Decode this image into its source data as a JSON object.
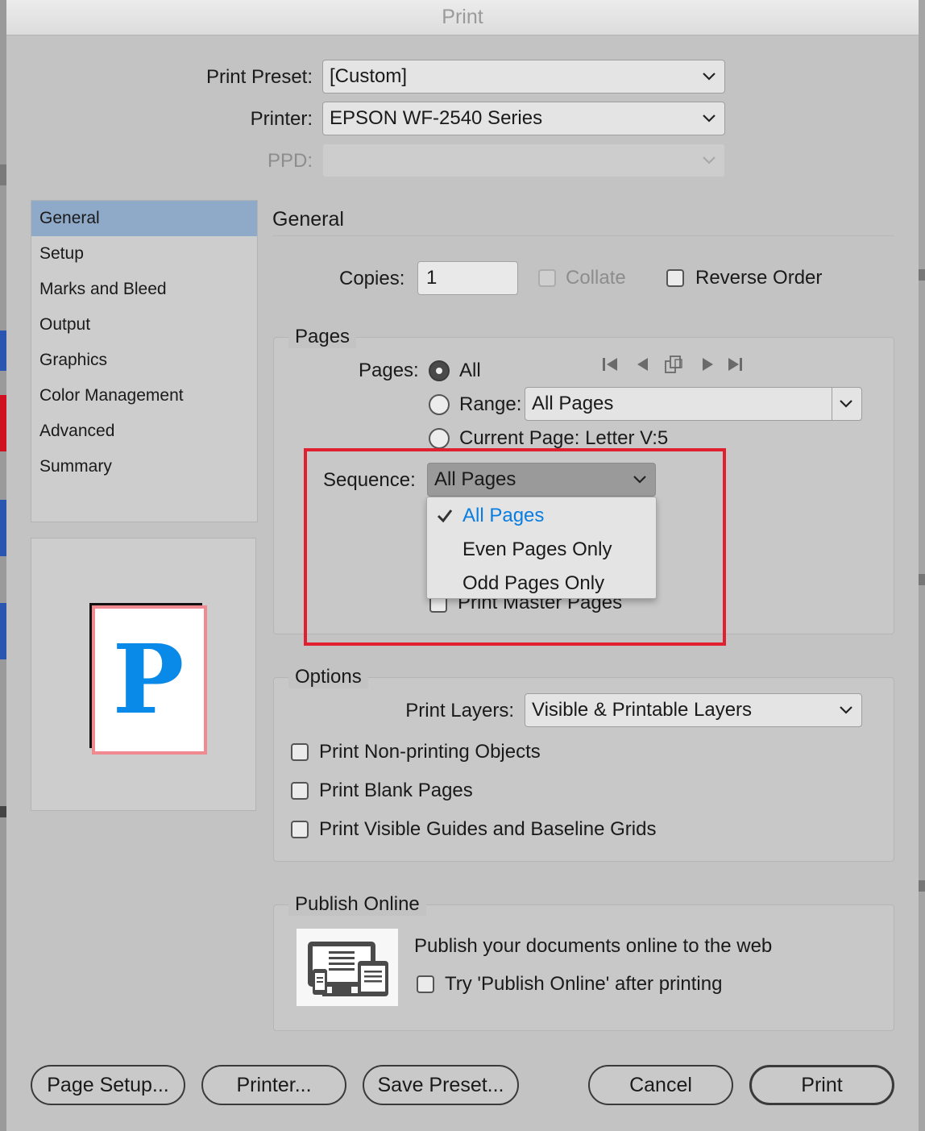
{
  "window": {
    "title": "Print"
  },
  "header": {
    "print_preset_label": "Print Preset:",
    "print_preset_value": "[Custom]",
    "printer_label": "Printer:",
    "printer_value": "EPSON WF-2540 Series",
    "ppd_label": "PPD:",
    "ppd_value": ""
  },
  "sidebar": {
    "selected": "General",
    "items": [
      {
        "label": "General"
      },
      {
        "label": "Setup"
      },
      {
        "label": "Marks and Bleed"
      },
      {
        "label": "Output"
      },
      {
        "label": "Graphics"
      },
      {
        "label": "Color Management"
      },
      {
        "label": "Advanced"
      },
      {
        "label": "Summary"
      }
    ]
  },
  "preview": {
    "glyph": "P",
    "glyph_color": "#0a8ae8",
    "border_color": "#f08a90"
  },
  "main": {
    "title": "General",
    "copies_label": "Copies:",
    "copies_value": "1",
    "collate_label": "Collate",
    "reverse_order_label": "Reverse Order"
  },
  "pages": {
    "group_title": "Pages",
    "pages_label": "Pages:",
    "all_label": "All",
    "range_label": "Range:",
    "range_value": "All Pages",
    "current_page_label": "Current Page: Letter V:5",
    "sequence_label": "Sequence:",
    "sequence_value": "All Pages",
    "sequence_options": [
      {
        "label": "All Pages",
        "checked": true
      },
      {
        "label": "Even Pages Only",
        "checked": false
      },
      {
        "label": "Odd Pages Only",
        "checked": false
      }
    ],
    "print_master_pages_label": "Print Master Pages",
    "highlight_color": "#e02030"
  },
  "options": {
    "group_title": "Options",
    "print_layers_label": "Print Layers:",
    "print_layers_value": "Visible & Printable Layers",
    "non_printing_label": "Print Non-printing Objects",
    "blank_pages_label": "Print Blank Pages",
    "guides_label": "Print Visible Guides and Baseline Grids"
  },
  "publish": {
    "group_title": "Publish Online",
    "headline": "Publish your documents online to the web",
    "try_label": "Try 'Publish Online' after printing"
  },
  "footer": {
    "page_setup": "Page Setup...",
    "printer": "Printer...",
    "save_preset": "Save Preset...",
    "cancel": "Cancel",
    "print": "Print"
  }
}
